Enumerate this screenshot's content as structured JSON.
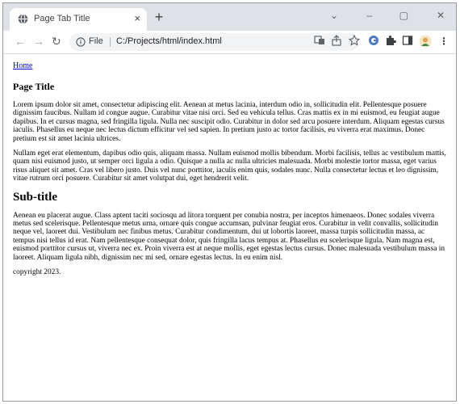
{
  "browser": {
    "tab": {
      "title": "Page Tab Title",
      "close_glyph": "×",
      "favicon": "globe-icon"
    },
    "new_tab_glyph": "+",
    "window_controls": {
      "dropdown_glyph": "⌄",
      "minimize_glyph": "–",
      "maximize_glyph": "▢",
      "close_glyph": "✕"
    },
    "nav": {
      "back_glyph": "←",
      "forward_glyph": "→",
      "reload_glyph": "↻"
    },
    "address": {
      "scheme_label": "File",
      "url": "C:/Projects/html/index.html"
    },
    "toolbar_icons": [
      "translate-icon",
      "share-icon",
      "star-icon",
      "extension-g-icon",
      "puzzle-icon",
      "sidepanel-icon",
      "profile-avatar-icon",
      "menu-icon"
    ],
    "menu_glyph": "⋮"
  },
  "page": {
    "home_link": "Home",
    "title": "Page Title",
    "paragraphs": [
      "Lorem ipsum dolor sit amet, consectetur adipiscing elit. Aenean at metus lacinia, interdum odio in, sollicitudin elit. Pellentesque posuere dignissim faucibus. Nullam id congue augue. Curabitur vitae nisi orci. Sed eu vehicula tellus. Cras mattis ex in mi euismod, eu feugiat augue dapibus. In et cursus magna, sed fringilla ligula. Nulla nec suscipit odio. Curabitur in dolor sed arcu posuere interdum. Aliquam egestas cursus iaculis. Phasellus eu neque nec lectus dictum efficitur vel sed sapien. In pretium justo ac tortor facilisis, eu viverra erat maximus. Donec pretium est sit amet lacinia ultrices.",
      "Nullam eget erat elementum, dapibus odio quis, aliquam massa. Nullam euismod mollis bibendum. Morbi facilisis, tellus ac vestibulum mattis, quam nisi euismod justo, ut semper orci ligula a odio. Quisque a nulla ac nulla ultricies malesuada. Morbi molestie tortor massa, eget varius risus aliquet sit amet. Cras vel libero justo. Duis vel nunc porttitor, iaculis enim quis, sodales nunc. Nulla consectetur lectus et leo dignissim, vitae rutrum orci posuere. Curabitur sit amet volutpat dui, eget hendrerit velit."
    ],
    "subtitle": "Sub-title",
    "sub_paragraph": "Aenean eu placerat augue. Class aptent taciti sociosqu ad litora torquent per conubia nostra, per inceptos himenaeos. Donec sodales viverra metus sed scelerisque. Pellentesque metus urna, ornare quis congue accumsan, pulvinar feugiat eros. Curabitur in velit convallis, sollicitudin neque vel, laoreet dui. Vestibulum nec finibus metus. Curabitur condimentum, dui ut lobortis laoreet, massa turpis sollicitudin massa, ac tempus nisi tellus id erat. Nam pellentesque consequat dolor, quis fringilla lacus tempus at. Phasellus eu scelerisque ligula. Nam magna est, euismod porttitor cursus ut, viverra nec ex. Proin viverra est at neque mollis, eget egestas lectus cursus. Donec malesuada vestibulum massa in laoreet. Aliquam ligula nibh, dignissim nec mi sed, ornare egestas lectus. In eu enim nisl.",
    "footer": "copyright 2023."
  }
}
